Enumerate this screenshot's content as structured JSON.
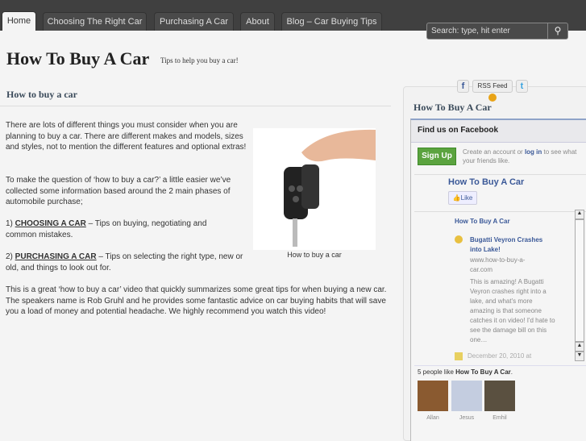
{
  "nav": {
    "tabs": [
      {
        "label": "Home",
        "active": true
      },
      {
        "label": "Choosing The Right Car"
      },
      {
        "label": "Purchasing A Car"
      },
      {
        "label": "About"
      },
      {
        "label": "Blog – Car Buying Tips"
      }
    ]
  },
  "search": {
    "placeholder": "Search: type, hit enter",
    "icon": "search-icon"
  },
  "site": {
    "title": "How To Buy A Car",
    "tagline": "Tips to help you buy a car!"
  },
  "post": {
    "heading": "How to buy a car",
    "p1": "There are lots of different things you must consider when you are planning to buy a car. There are different makes and models, sizes and styles, not to mention the different features and optional extras!",
    "p2": "To make the question of ‘how to buy a car?’ a little easier we’ve  collected some information based around the 2 main phases of automobile purchase;",
    "p3_prefix": "1) ",
    "p3_link": "CHOOSING A CAR",
    "p3_rest": " – Tips on buying, negotiating and common mistakes.",
    "p4_prefix": "2) ",
    "p4_link": "PURCHASING A CAR",
    "p4_rest": " – Tips on selecting the right type, new or old, and things to look out for.",
    "p5": "This is a great ‘how to buy a car’ video that quickly summarizes some great tips for when buying a new car. The speakers name is Rob Gruhl and he provides some fantastic advice on car buying habits that will save you a load of money and potential headache. We highly recommend you watch this video!",
    "image_caption": "How to buy a car"
  },
  "sidebar": {
    "rss": "RSS Feed",
    "title": "How To Buy A Car",
    "facebook": {
      "header": "Find us on Facebook",
      "signup": "Sign Up",
      "create_pre": "Create an account or ",
      "login": "log in",
      "create_post": " to see what your friends like.",
      "page_name": "How To Buy A Car",
      "like": "Like",
      "stream_page": "How To Buy A Car",
      "post_title": "Bugatti Veyron Crashes into Lake!",
      "post_url": "www.how-to-buy-a-car.com",
      "post_text": "This is amazing! A Bugatti Veyron crashes right into a lake, and what's more amazing is that someone catches it on video! I'd hate to see the damage bill on this one…",
      "post_date": "December 20, 2010 at",
      "likes_pre": "5 people like ",
      "likes_page": "How To Buy A Car",
      "likes_post": ".",
      "fans": [
        "Allan",
        "Jesus",
        "Emhil"
      ]
    }
  },
  "colors": {
    "topbar": "#404040",
    "fb_blue": "#3b5998",
    "signup_green": "#5ba33f"
  }
}
